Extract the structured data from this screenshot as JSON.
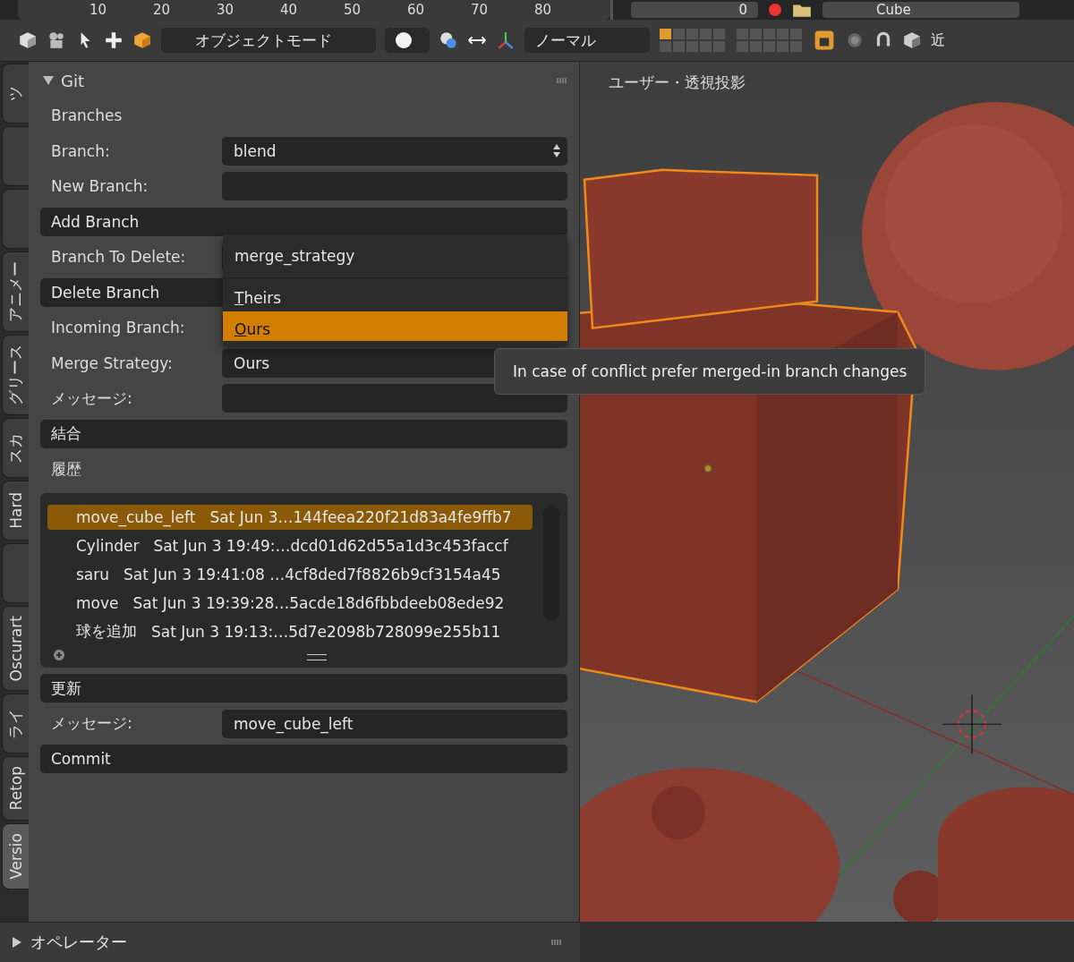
{
  "ruler": {
    "ticks": [
      "10",
      "20",
      "30",
      "40",
      "50",
      "60",
      "70",
      "80"
    ]
  },
  "timeline": {
    "frame": "0",
    "object_name": "Cube"
  },
  "toolbar": {
    "mode": "オブジェクトモード",
    "orientation": "ノーマル",
    "snap": "近"
  },
  "side_tabs": [
    {
      "label": "ツ",
      "selected": false
    },
    {
      "selected": false
    },
    {
      "selected": false
    },
    {
      "label": "アニメー",
      "selected": false
    },
    {
      "label": "グリース",
      "selected": false
    },
    {
      "label": "スカ",
      "selected": false
    },
    {
      "label": "Hard",
      "selected": false
    },
    {
      "selected": false
    },
    {
      "label": "Oscurart",
      "selected": false
    },
    {
      "label": "ライ",
      "selected": false
    },
    {
      "label": "Retop",
      "selected": false
    },
    {
      "label": "Versio",
      "selected": true
    }
  ],
  "panel": {
    "title": "Git",
    "expanded": true,
    "rows": [
      {
        "kind": "heading",
        "label": "Branches"
      },
      {
        "kind": "dropdown",
        "label": "Branch:",
        "value": "blend"
      },
      {
        "kind": "field",
        "label": "New Branch:"
      },
      {
        "kind": "button",
        "label": "Add Branch"
      },
      {
        "kind": "field",
        "label": "Branch To Delete:"
      },
      {
        "kind": "button",
        "label": "Delete Branch"
      },
      {
        "kind": "field",
        "label": "Incoming Branch:"
      },
      {
        "kind": "dropdown",
        "label": "Merge Strategy:",
        "value": "Ours"
      },
      {
        "kind": "field",
        "label": "メッセージ:"
      },
      {
        "kind": "button",
        "label": "結合"
      },
      {
        "kind": "heading",
        "label": "履歴"
      },
      {
        "kind": "list",
        "items": [
          {
            "name": "move_cube_left",
            "detail": "Sat Jun 3…144feea220f21d83a4fe9ffb7",
            "selected": true
          },
          {
            "name": "Cylinder",
            "detail": "Sat Jun 3 19:49:…dcd01d62d55a1d3c453faccf",
            "selected": false
          },
          {
            "name": "saru",
            "detail": "Sat Jun 3 19:41:08 …4cf8ded7f8826b9cf3154a45",
            "selected": false
          },
          {
            "name": "move",
            "detail": "Sat Jun 3 19:39:28…5acde18d6fbbdeeb08ede92",
            "selected": false
          },
          {
            "name": "球を追加",
            "detail": "Sat Jun 3 19:13:…5d7e2098b728099e255b11",
            "selected": false
          }
        ]
      },
      {
        "kind": "button",
        "label": "更新"
      },
      {
        "kind": "field",
        "label": "メッセージ:",
        "value": "move_cube_left"
      },
      {
        "kind": "button",
        "label": "Commit"
      }
    ]
  },
  "menu": {
    "title": "merge_strategy",
    "options": [
      {
        "label": "Theirs",
        "selected": false
      },
      {
        "label": "Ours",
        "selected": true
      }
    ]
  },
  "tooltip": "In case of conflict prefer merged-in branch changes",
  "viewport": {
    "label": "ユーザー・透視投影"
  },
  "operator_panel": {
    "title": "オペレーター",
    "expanded": false
  }
}
